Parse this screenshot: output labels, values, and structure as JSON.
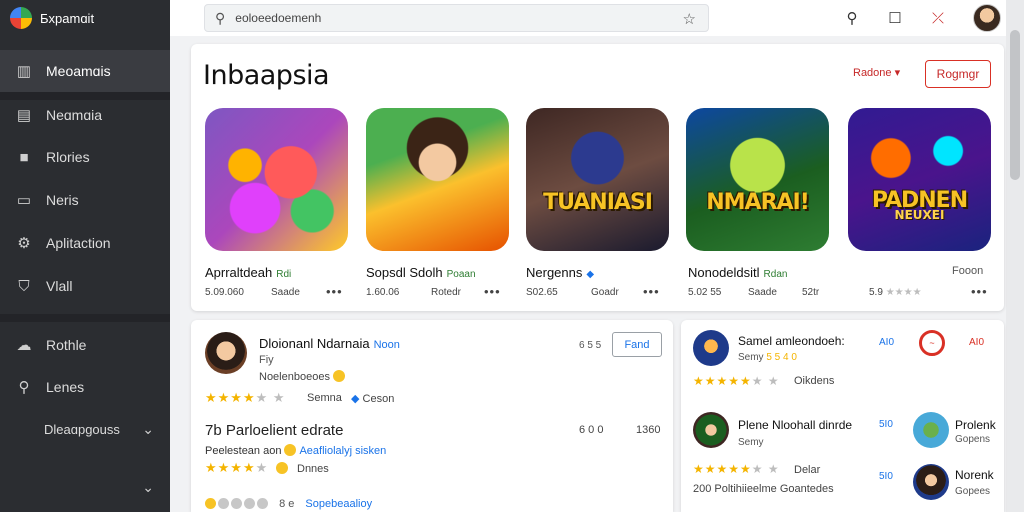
{
  "app": {
    "title": "Бxpamɑit"
  },
  "sidebar": {
    "items": [
      {
        "label": "Meoamɑis",
        "icon": "library-icon"
      },
      {
        "label": "Neɑmɑia",
        "icon": "chart-icon"
      },
      {
        "label": "Rlories",
        "icon": "square-icon"
      },
      {
        "label": "Neris",
        "icon": "news-icon"
      },
      {
        "label": "Aplitaction",
        "icon": "gear-icon"
      },
      {
        "label": "Vlall",
        "icon": "shield-icon"
      },
      {
        "label": "Rothle",
        "icon": "cloud-icon"
      },
      {
        "label": "Lenes",
        "icon": "search-icon"
      },
      {
        "label": "Dleaɑpɡouss"
      }
    ]
  },
  "search": {
    "value": "eoloeedoemenh"
  },
  "featured": {
    "title": "Inbaapsia",
    "dropdown_label": "Radone",
    "button_label": "Rogmgr",
    "apps": [
      {
        "name": "Aprraltdeah",
        "tag": "Rdi",
        "meta1": "5.09.060",
        "meta2": "Saade",
        "badge": "",
        "badge2": ""
      },
      {
        "name": "Sopsdl Sdolh",
        "tag": "Poaan",
        "meta1": "1.60.06",
        "meta2": "Rotedr",
        "badge": "",
        "badge2": ""
      },
      {
        "name": "Nergenns",
        "tag": "",
        "meta1": "S02.65",
        "meta2": "Goadr",
        "badge": "TUANIASI",
        "badge2": ""
      },
      {
        "name": "Nonodeldsitl",
        "tag": "Rdan",
        "meta1": "5.02 55",
        "meta2": "Saade",
        "meta3": "52tr",
        "badge": "NMARAI!",
        "badge2": ""
      },
      {
        "name": "",
        "tag": "",
        "meta1": "5.9",
        "meta2": "",
        "side_label": "Fooon",
        "badge": "PADNEN",
        "badge2": "NEUXEI"
      }
    ]
  },
  "reviews": {
    "user": "Dloionanl Ndarnaia",
    "user_tag": "Noon",
    "sub1": "Fiy",
    "sub2": "Noelenboeoes",
    "stars1_label": "Semna",
    "stars1_label2": "Ceson",
    "count": "6 5 5",
    "button_label": "Fand",
    "heading": "7b Parloelient edrate",
    "num1": "6 0 0",
    "num2": "1360",
    "line2_text": "Peelestean aon",
    "line2_link": "Aeafliolalyj sisken",
    "stars2_label": "Dnnes",
    "bottom_link": "Sopebeaalioy",
    "bottom_prefix": "8 e"
  },
  "side": {
    "rows": [
      {
        "name": "Samel amleondoeh:",
        "sub": "Semy",
        "sub_hl": "5 5 4 0",
        "val": "AI0",
        "val2": "AI0",
        "ring": "~"
      },
      {
        "stars_label": "Oikdens"
      },
      {
        "name": "Plene Nloohall dinrde",
        "sub": "Semy",
        "val": "5I0",
        "name2": "Prolenk",
        "sub2": "Gopens"
      },
      {
        "stars_label": "Delar",
        "val": "5I0",
        "name2": "Norenk",
        "sub2": "Gopees"
      },
      {
        "bottom": "200 Poltihiieelme Goantedes"
      }
    ]
  },
  "colors": {
    "accent": "#1a73e8",
    "brand_red": "#d93025",
    "star": "#f4b400",
    "sidebar": "#2b2d31"
  }
}
